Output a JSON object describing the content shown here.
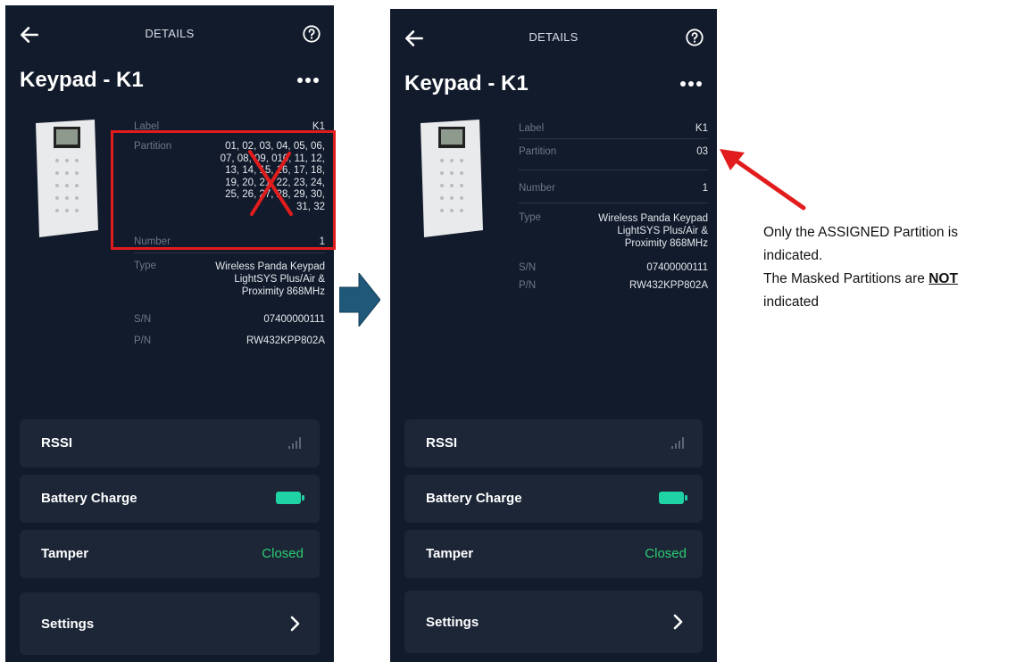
{
  "left_screen": {
    "topbar_title": "DETAILS",
    "device_title": "Keypad - K1",
    "details": {
      "label_key": "Label",
      "label_value": "K1",
      "partition_key": "Partition",
      "partition_value": "01, 02, 03, 04, 05, 06, 07, 08, 09, 010, 11, 12, 13, 14, 15, 16, 17, 18, 19, 20, 21, 22, 23, 24, 25, 26, 27, 28, 29, 30, 31, 32",
      "number_key": "Number",
      "number_value": "1",
      "type_key": "Type",
      "type_value": "Wireless Panda Keypad LightSYS Plus/Air & Proximity 868MHz",
      "sn_key": "S/N",
      "sn_value": "07400000111",
      "pn_key": "P/N",
      "pn_value": "RW432KPP802A"
    },
    "cards": {
      "rssi": "RSSI",
      "battery": "Battery Charge",
      "tamper": "Tamper",
      "tamper_status": "Closed",
      "settings": "Settings"
    }
  },
  "right_screen": {
    "topbar_title": "DETAILS",
    "device_title": "Keypad - K1",
    "details": {
      "label_key": "Label",
      "label_value": "K1",
      "partition_key": "Partition",
      "partition_value": "03",
      "number_key": "Number",
      "number_value": "1",
      "type_key": "Type",
      "type_value": "Wireless Panda Keypad LightSYS Plus/Air & Proximity 868MHz",
      "sn_key": "S/N",
      "sn_value": "07400000111",
      "pn_key": "P/N",
      "pn_value": "RW432KPP802A"
    },
    "cards": {
      "rssi": "RSSI",
      "battery": "Battery Charge",
      "tamper": "Tamper",
      "tamper_status": "Closed",
      "settings": "Settings"
    }
  },
  "annotation": {
    "line1": "Only the ASSIGNED Partition is indicated.",
    "line2_prefix": "The Masked Partitions are ",
    "line2_emph": "NOT",
    "line2_suffix": "indicated"
  },
  "colors": {
    "screen_bg": "#121b2b",
    "card_bg": "#1c2637",
    "status_green": "#2ecc71",
    "battery_teal": "#1fd3a5",
    "highlight_red": "#e21c1c",
    "flow_arrow": "#1f5878"
  },
  "icons": [
    "back-arrow-icon",
    "help-icon",
    "more-icon",
    "signal-icon",
    "battery-icon",
    "chevron-right-icon",
    "cross-out-icon",
    "flow-arrow-icon",
    "pointer-arrow-icon"
  ]
}
